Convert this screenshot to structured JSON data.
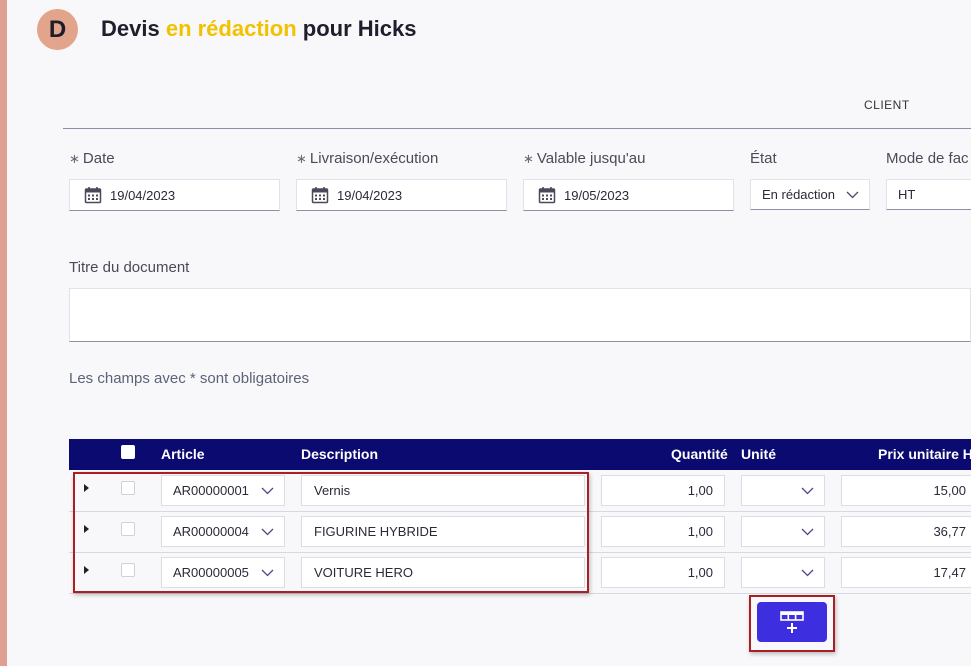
{
  "header": {
    "avatar_letter": "D",
    "title_prefix": "Devis ",
    "title_status": "en rédaction",
    "title_suffix": " pour Hicks",
    "status_color": "#f2c200"
  },
  "tabs": {
    "client": "CLIENT"
  },
  "fields": {
    "required_marker": "∗",
    "date": {
      "label": "Date",
      "value": "19/04/2023"
    },
    "livraison": {
      "label": "Livraison/exécution",
      "value": "19/04/2023"
    },
    "valable": {
      "label": "Valable jusqu'au",
      "value": "19/05/2023"
    },
    "etat": {
      "label": "État",
      "value": "En rédaction"
    },
    "mode": {
      "label": "Mode de fac",
      "value": "HT"
    }
  },
  "document_title": {
    "label": "Titre du document",
    "value": ""
  },
  "required_note": "Les champs avec * sont obligatoires",
  "table": {
    "headers": {
      "article": "Article",
      "description": "Description",
      "quantite": "Quantité",
      "unite": "Unité",
      "prix": "Prix unitaire HT"
    },
    "rows": [
      {
        "article": "AR00000001",
        "description": "Vernis",
        "quantite": "1,00",
        "unite": "",
        "prix": "15,00"
      },
      {
        "article": "AR00000004",
        "description": "FIGURINE HYBRIDE",
        "quantite": "1,00",
        "unite": "",
        "prix": "36,77"
      },
      {
        "article": "AR00000005",
        "description": "VOITURE HERO",
        "quantite": "1,00",
        "unite": "",
        "prix": "17,47"
      }
    ]
  },
  "add_button": {
    "icon": "table-add-row-icon"
  },
  "colors": {
    "table_header_bg": "#0a0a70",
    "add_button_bg": "#3d2ee0",
    "highlight_border": "#a81f28",
    "left_strip": "#dea092"
  }
}
